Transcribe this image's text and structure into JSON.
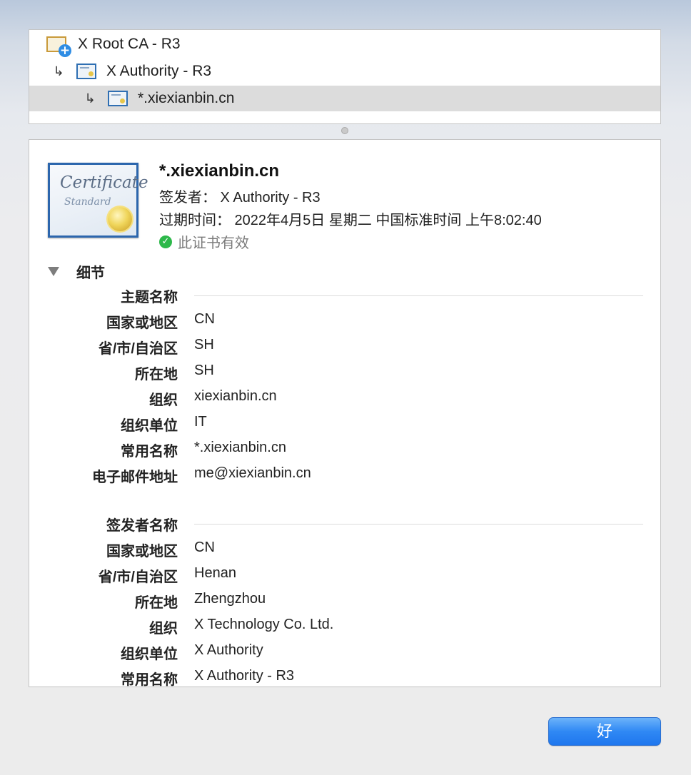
{
  "chain": [
    {
      "label": "X Root CA - R3"
    },
    {
      "label": "X Authority - R3"
    },
    {
      "label": "*.xiexianbin.cn"
    }
  ],
  "chain_arrow": "↳",
  "header": {
    "cert_art_text": "Certificate",
    "cert_art_subtext": "Standard",
    "title": "*.xiexianbin.cn",
    "issuer": "签发者： X Authority - R3",
    "expiry": "过期时间： 2022年4月5日 星期二 中国标准时间 上午8:02:40",
    "valid": "此证书有效"
  },
  "details_label": "细节",
  "subject": {
    "section": "主题名称",
    "rows": [
      {
        "key": "国家或地区",
        "value": "CN"
      },
      {
        "key": "省/市/自治区",
        "value": "SH"
      },
      {
        "key": "所在地",
        "value": "SH"
      },
      {
        "key": "组织",
        "value": "xiexianbin.cn"
      },
      {
        "key": "组织单位",
        "value": "IT"
      },
      {
        "key": "常用名称",
        "value": "*.xiexianbin.cn"
      },
      {
        "key": "电子邮件地址",
        "value": "me@xiexianbin.cn"
      }
    ]
  },
  "issuer_name": {
    "section": "签发者名称",
    "rows": [
      {
        "key": "国家或地区",
        "value": "CN"
      },
      {
        "key": "省/市/自治区",
        "value": "Henan"
      },
      {
        "key": "所在地",
        "value": "Zhengzhou"
      },
      {
        "key": "组织",
        "value": "X Technology Co. Ltd."
      },
      {
        "key": "组织单位",
        "value": "X Authority"
      },
      {
        "key": "常用名称",
        "value": "X Authority - R3"
      }
    ]
  },
  "ok_label": "好",
  "icons": {
    "root_cert": "certificate-root-icon",
    "cert": "certificate-icon",
    "valid": "checkmark-circle-icon",
    "disclosure": "disclosure-triangle-icon"
  },
  "colors": {
    "accent": "#2f88f4",
    "valid_green": "#2db84a",
    "selection": "#dcdcdc"
  }
}
